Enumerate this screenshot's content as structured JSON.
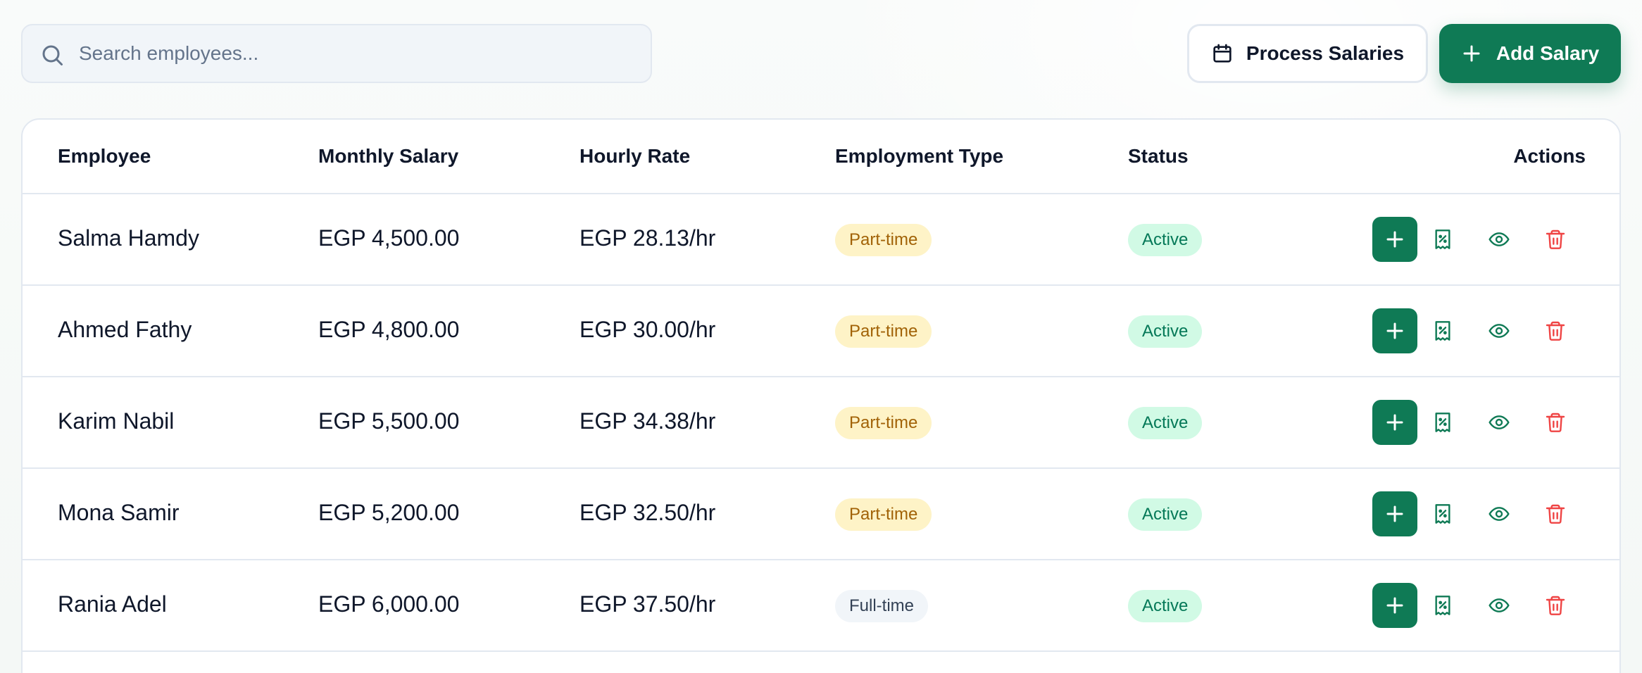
{
  "search": {
    "placeholder": "Search employees..."
  },
  "toolbar": {
    "process_label": "Process Salaries",
    "add_label": "Add Salary"
  },
  "table": {
    "headers": {
      "employee": "Employee",
      "monthly_salary": "Monthly Salary",
      "hourly_rate": "Hourly Rate",
      "employment_type": "Employment Type",
      "status": "Status",
      "actions": "Actions"
    },
    "rows": [
      {
        "employee": "Salma Hamdy",
        "monthly_salary": "EGP 4,500.00",
        "hourly_rate": "EGP 28.13/hr",
        "employment_type": "Part-time",
        "type_key": "parttime",
        "status": "Active"
      },
      {
        "employee": "Ahmed Fathy",
        "monthly_salary": "EGP 4,800.00",
        "hourly_rate": "EGP 30.00/hr",
        "employment_type": "Part-time",
        "type_key": "parttime",
        "status": "Active"
      },
      {
        "employee": "Karim Nabil",
        "monthly_salary": "EGP 5,500.00",
        "hourly_rate": "EGP 34.38/hr",
        "employment_type": "Part-time",
        "type_key": "parttime",
        "status": "Active"
      },
      {
        "employee": "Mona Samir",
        "monthly_salary": "EGP 5,200.00",
        "hourly_rate": "EGP 32.50/hr",
        "employment_type": "Part-time",
        "type_key": "parttime",
        "status": "Active"
      },
      {
        "employee": "Rania Adel",
        "monthly_salary": "EGP 6,000.00",
        "hourly_rate": "EGP 37.50/hr",
        "employment_type": "Full-time",
        "type_key": "fulltime",
        "status": "Active"
      }
    ]
  },
  "icons": {
    "search": "search-icon",
    "calendar": "calendar-icon",
    "plus": "plus-icon",
    "receipt": "receipt-percent-icon",
    "view": "eye-icon",
    "delete": "trash-icon"
  },
  "colors": {
    "primary": "#0f7a55",
    "danger": "#ef4444",
    "badge_parttime_bg": "#fef3c7",
    "badge_parttime_text": "#a16207",
    "badge_fulltime_bg": "#f1f5f9",
    "badge_active_bg": "#d1fae5",
    "badge_active_text": "#047857"
  }
}
